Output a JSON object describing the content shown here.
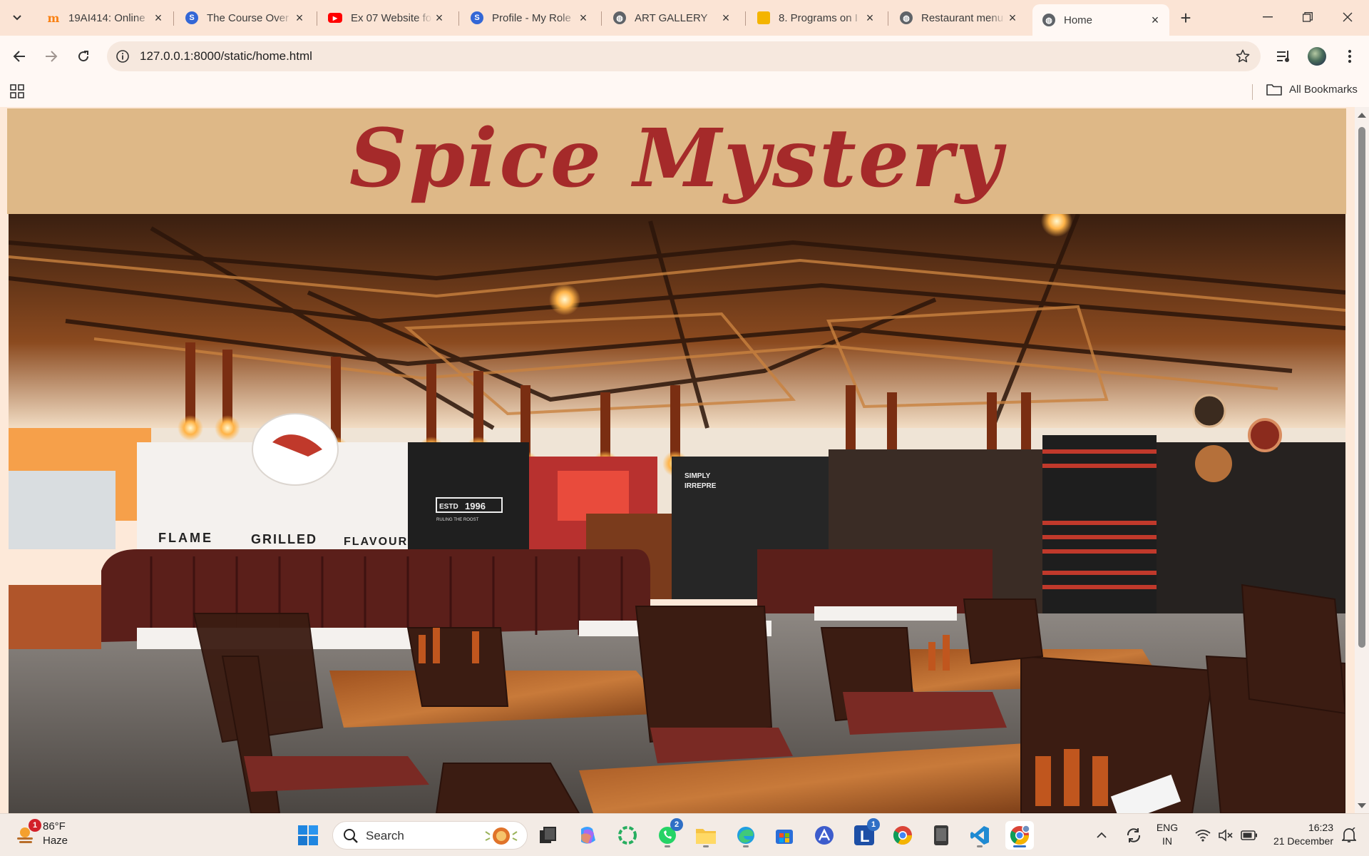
{
  "browser": {
    "tabs": [
      {
        "title": "19AI414: Online",
        "favicon": "moodle-icon",
        "color": "#f98012"
      },
      {
        "title": "The Course Over",
        "favicon": "course-icon",
        "color": "#3367d6"
      },
      {
        "title": "Ex 07 Website fo",
        "favicon": "youtube-icon",
        "color": "#ff0000"
      },
      {
        "title": "Profile - My Role",
        "favicon": "profile-icon",
        "color": "#3367d6"
      },
      {
        "title": "ART GALLERY",
        "favicon": "globe-icon",
        "color": "#5f6368"
      },
      {
        "title": "8. Programs on I",
        "favicon": "slides-icon",
        "color": "#f4b400"
      },
      {
        "title": "Restaurant menu",
        "favicon": "globe-icon",
        "color": "#5f6368"
      },
      {
        "title": "Home",
        "favicon": "globe-icon",
        "color": "#5f6368"
      }
    ],
    "active_tab_index": 7,
    "address": {
      "url": "127.0.0.1:8000/static/home.html"
    },
    "bookmarks": {
      "all_label": "All Bookmarks"
    }
  },
  "page": {
    "site_title": "Spice Mystery",
    "hero_image": "restaurant-interior-photo",
    "photo_signage": {
      "left_wall": [
        "FLAME",
        "GRILLED",
        "FLAVOUR"
      ],
      "badge_line1": "ESTD",
      "badge_year": "1996",
      "badge_sub": "RULING THE ROOST",
      "panel_line1": "SIMPLY",
      "panel_line2": "IRREPRE"
    },
    "colors": {
      "banner": "#deb887",
      "title": "#a52a2a",
      "page_bg": "#fde9d9"
    }
  },
  "taskbar": {
    "weather": {
      "temp": "86°F",
      "condition": "Haze",
      "alert_count": "1"
    },
    "search_label": "Search",
    "apps": [
      {
        "name": "start-icon"
      },
      {
        "name": "task-view-icon"
      },
      {
        "name": "copilot-icon"
      },
      {
        "name": "app-green-circle-icon"
      },
      {
        "name": "whatsapp-icon",
        "badge": "2"
      },
      {
        "name": "file-explorer-icon"
      },
      {
        "name": "edge-icon"
      },
      {
        "name": "store-icon"
      },
      {
        "name": "app-triangle-icon"
      },
      {
        "name": "app-l-icon",
        "badge": "1"
      },
      {
        "name": "chrome-icon"
      },
      {
        "name": "app-phone-icon"
      },
      {
        "name": "vscode-icon"
      },
      {
        "name": "chrome-active-icon"
      }
    ],
    "tray": {
      "lang_line1": "ENG",
      "lang_line2": "IN",
      "time": "16:23",
      "date": "21 December"
    }
  }
}
